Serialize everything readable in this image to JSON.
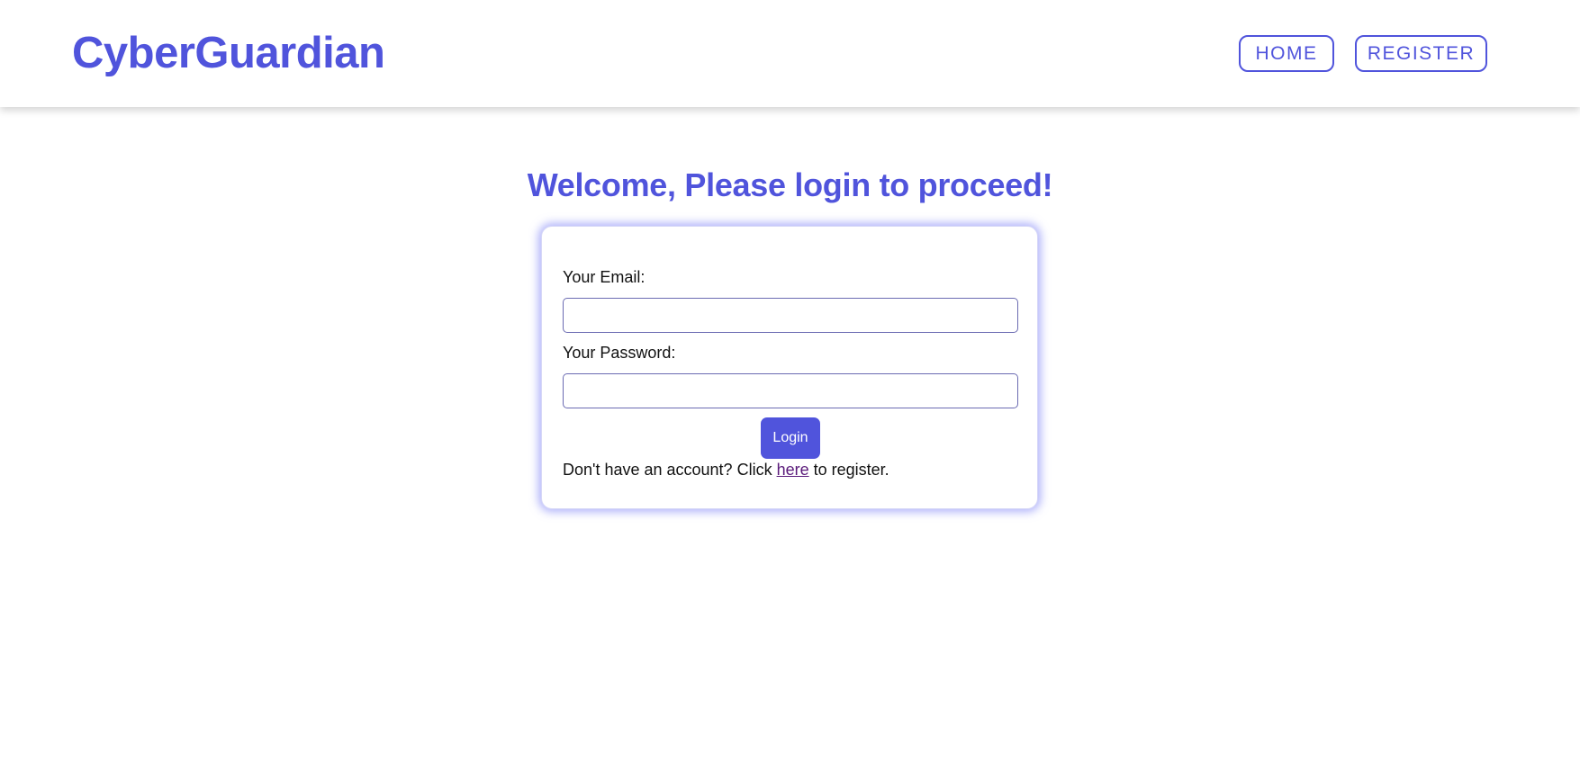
{
  "navbar": {
    "brand": "CyberGuardian",
    "home_label": "HOME",
    "register_label": "REGISTER"
  },
  "main": {
    "title": "Welcome, Please login to proceed!"
  },
  "form": {
    "email_label": "Your Email:",
    "email_value": "",
    "password_label": "Your Password:",
    "password_value": "",
    "login_label": "Login",
    "footer_prefix": "Don't have an account? Click ",
    "footer_link": "here",
    "footer_suffix": " to register."
  },
  "colors": {
    "accent": "#5054dc",
    "link_visited": "#5a1a7a",
    "card_glow": "#6e72f5"
  }
}
